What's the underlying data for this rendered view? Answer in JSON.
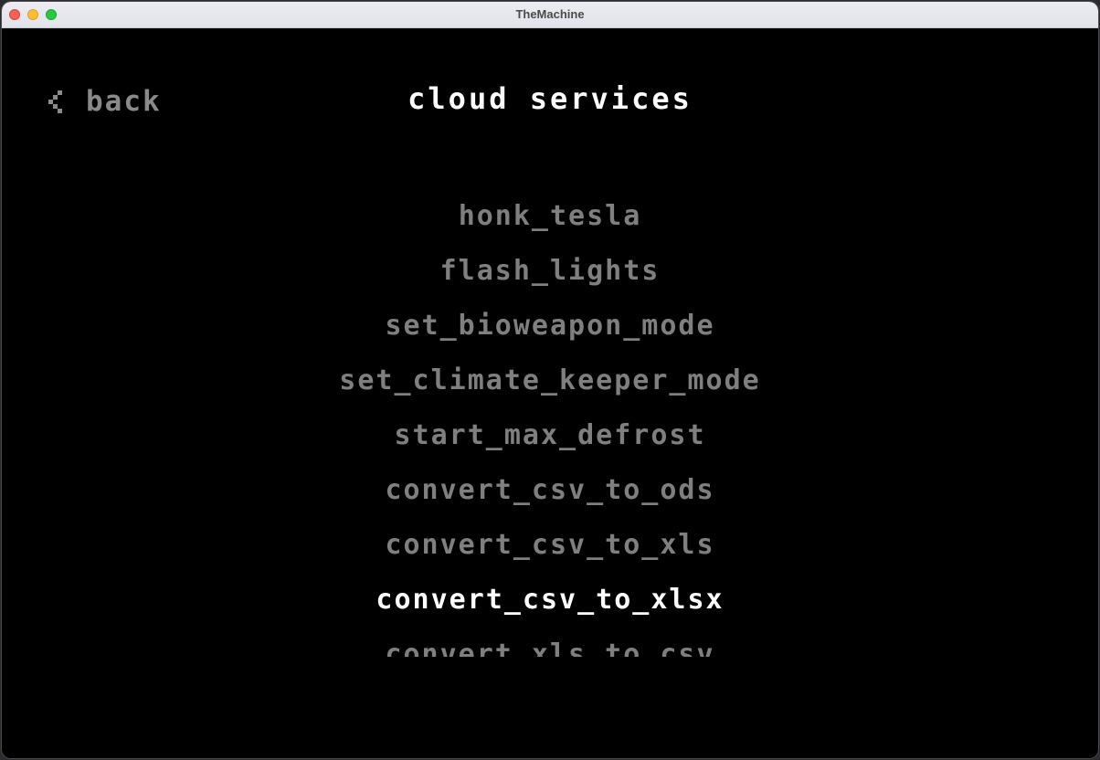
{
  "window": {
    "title": "TheMachine"
  },
  "header": {
    "back_label": "back",
    "back_icon": "chevron-left-icon",
    "title": "cloud services"
  },
  "services": {
    "selected_index": 7,
    "items": [
      "honk_tesla",
      "flash_lights",
      "set_bioweapon_mode",
      "set_climate_keeper_mode",
      "start_max_defrost",
      "convert_csv_to_ods",
      "convert_csv_to_xls",
      "convert_csv_to_xlsx",
      "convert_xls_to_csv"
    ]
  },
  "colors": {
    "background": "#000000",
    "text_selected": "#ffffff",
    "text_unselected": "#7f7f7f"
  }
}
